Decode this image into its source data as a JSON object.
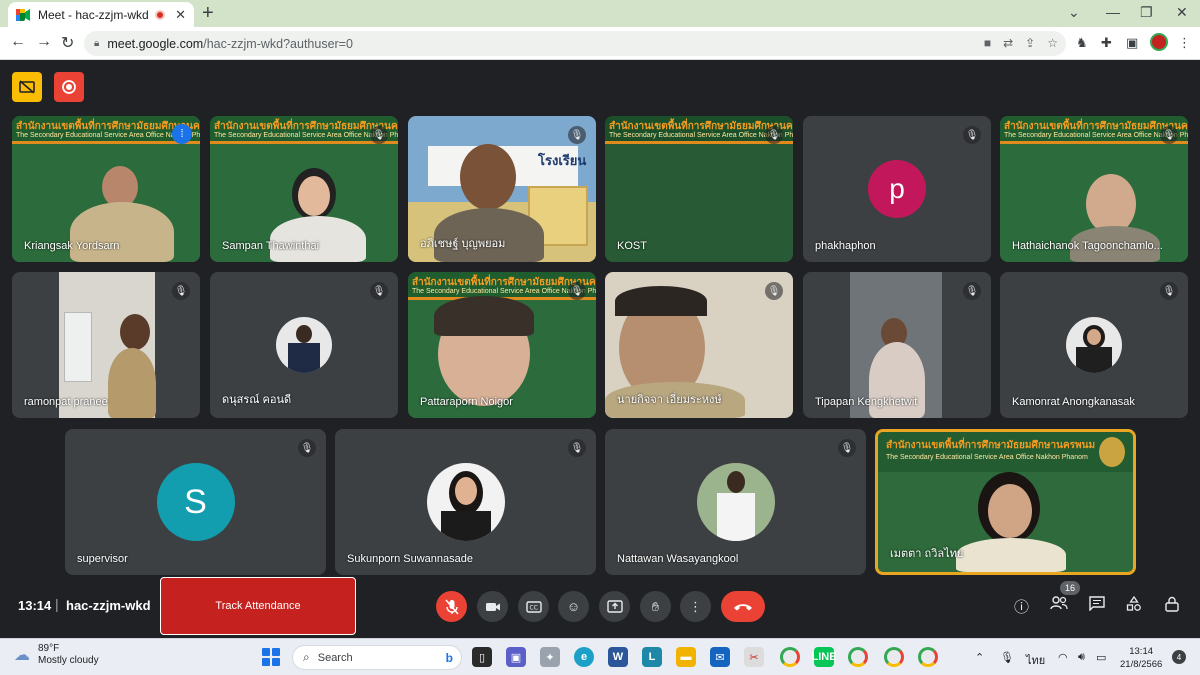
{
  "browser": {
    "tab_title": "Meet - hac-zzjm-wkd",
    "url_host": "meet.google.com",
    "url_path": "/hac-zzjm-wkd?authuser=0"
  },
  "participants": [
    {
      "name": "Kriangsak Yordsarn",
      "kind": "video-banner",
      "speaking": true
    },
    {
      "name": "Sampan Thawinthai",
      "kind": "video-banner",
      "muted": true
    },
    {
      "name": "อภิเชษฐ์ บุญพยอม",
      "kind": "video-school",
      "muted": true
    },
    {
      "name": "KOST",
      "kind": "video-banner-dim",
      "muted": true
    },
    {
      "name": "phakhaphon",
      "kind": "letter-avatar",
      "letter": "p",
      "avatar_color": "#c2185b",
      "muted": true
    },
    {
      "name": "Hathaichanok Tagoonchamlo...",
      "kind": "video-banner",
      "muted": true
    },
    {
      "name": "ramonpat pranee",
      "kind": "video-room",
      "muted": true
    },
    {
      "name": "ดนุสรณ์ คอนดี",
      "kind": "photo-avatar",
      "muted": true
    },
    {
      "name": "Pattaraporn Noigor",
      "kind": "video-banner",
      "muted": true
    },
    {
      "name": "นายกิจจา เอี่ยมระหงษ์",
      "kind": "video-room",
      "muted": true
    },
    {
      "name": "Tipapan Kengkhetwit",
      "kind": "video-room",
      "muted": true
    },
    {
      "name": "Kamonrat Anongkanasak",
      "kind": "photo-avatar",
      "muted": true
    },
    {
      "name": "supervisor",
      "kind": "letter-avatar",
      "letter": "S",
      "avatar_color": "#129eaf",
      "muted": true
    },
    {
      "name": "Sukunporn Suwannasade",
      "kind": "photo-avatar",
      "muted": true
    },
    {
      "name": "Nattawan Wasayangkool",
      "kind": "photo-avatar",
      "muted": true
    },
    {
      "name": "เมตตา ถวิลไทย",
      "kind": "video-banner-framed"
    }
  ],
  "banner_text": {
    "line1": "สำนักงานเขตพื้นที่การศึกษามัธยมศึกษานครพนม",
    "line2": "The Secondary Educational Service Area Office Nakhon Phanom"
  },
  "school_sign": "โรงเรียน",
  "bottom": {
    "time": "13:14",
    "meeting_code": "hac-zzjm-wkd",
    "track_label": "Track Attendance",
    "people_count": "16"
  },
  "taskbar": {
    "temp": "89°F",
    "weather": "Mostly cloudy",
    "search_placeholder": "Search",
    "lang": "ไทย",
    "time": "13:14",
    "date": "21/8/2566",
    "notif_count": "4"
  }
}
